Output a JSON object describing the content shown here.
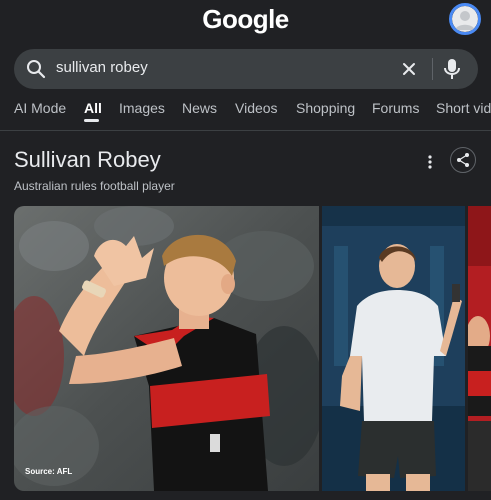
{
  "header": {
    "logo_text": "Google",
    "avatar_icon": "account-avatar-icon"
  },
  "search": {
    "query": "sullivan robey",
    "icons": [
      "search-icon",
      "clear-icon",
      "mic-icon"
    ]
  },
  "tabs": [
    {
      "label": "AI Mode",
      "active": false
    },
    {
      "label": "All",
      "active": true
    },
    {
      "label": "Images",
      "active": false
    },
    {
      "label": "News",
      "active": false
    },
    {
      "label": "Videos",
      "active": false
    },
    {
      "label": "Shopping",
      "active": false
    },
    {
      "label": "Forums",
      "active": false
    },
    {
      "label": "Short vide",
      "active": false
    }
  ],
  "knowledge_panel": {
    "title": "Sullivan Robey",
    "subtitle": "Australian rules football player",
    "icons": [
      "more-vert-icon",
      "share-icon"
    ],
    "images": [
      {
        "source_label": "Source: AFL"
      },
      {
        "source_label": ""
      },
      {
        "source_label": ""
      }
    ]
  },
  "colors": {
    "background": "#202124",
    "search_bar": "#3c4043",
    "active_tab": "#ffffff",
    "inactive_tab": "#bdc1c6",
    "avatar_ring": "#4a8af4"
  }
}
